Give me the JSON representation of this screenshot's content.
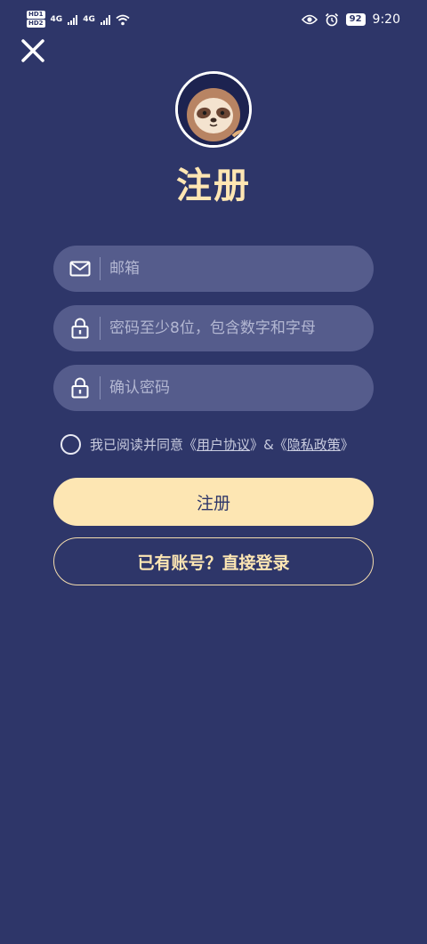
{
  "status_bar": {
    "hd1": "HD1",
    "hd2": "HD2",
    "net1": "4G",
    "net2": "4G",
    "battery": "92",
    "time": "9:20"
  },
  "header": {
    "title": "注册"
  },
  "form": {
    "email_placeholder": "邮箱",
    "password_placeholder": "密码至少8位，包含数字和字母",
    "confirm_placeholder": "确认密码"
  },
  "agreement": {
    "prefix": "我已阅读并同意",
    "open1": "《",
    "user_agreement": "用户协议",
    "close1": "》",
    "amp": "&",
    "open2": "《",
    "privacy_policy": "隐私政策",
    "close2": "》"
  },
  "actions": {
    "register_label": "注册",
    "login_label": "已有账号？直接登录"
  },
  "colors": {
    "background": "#2e3669",
    "accent": "#fde6b3",
    "field": "#555c8c"
  }
}
